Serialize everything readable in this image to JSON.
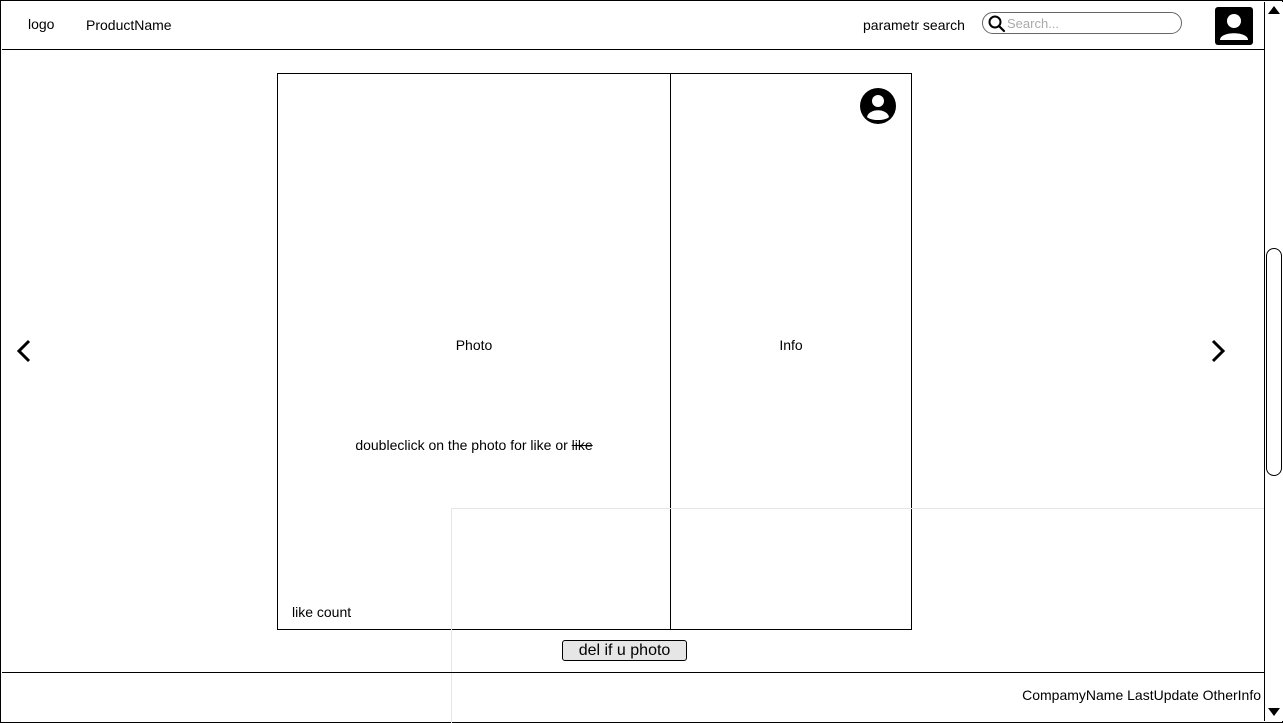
{
  "header": {
    "logo": "logo",
    "product_name": "ProductName",
    "param_search_label": "parametr search",
    "search": {
      "placeholder": "Search...",
      "value": ""
    },
    "user_icon": "user-account-icon"
  },
  "card": {
    "photo_label": "Photo",
    "hint_prefix": "doubleclick on the photo for like or ",
    "hint_struck": "like",
    "like_count_label": "like count",
    "info_label": "Info",
    "author_icon": "user-circle-icon"
  },
  "navigation": {
    "prev_icon": "chevron-left-icon",
    "next_icon": "chevron-right-icon"
  },
  "actions": {
    "delete_label": "del if u photo"
  },
  "footer": {
    "info": "CompamyName LastUpdate OtherInfo"
  }
}
